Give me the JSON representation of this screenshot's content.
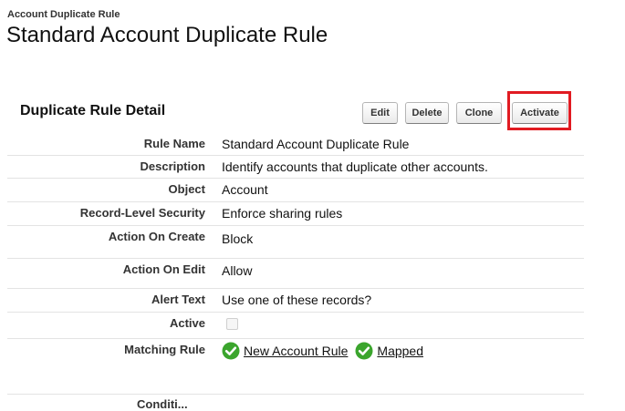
{
  "header": {
    "breadcrumb": "Account Duplicate Rule",
    "title": "Standard Account Duplicate Rule"
  },
  "section": {
    "title": "Duplicate Rule Detail",
    "buttons": {
      "edit": "Edit",
      "delete": "Delete",
      "clone": "Clone",
      "activate": "Activate"
    },
    "highlight_color": "#e11b22"
  },
  "fields": {
    "rule_name": {
      "label": "Rule Name",
      "value": "Standard Account Duplicate Rule"
    },
    "description": {
      "label": "Description",
      "value": "Identify accounts that duplicate other accounts."
    },
    "object": {
      "label": "Object",
      "value": "Account"
    },
    "record_level_security": {
      "label": "Record-Level Security",
      "value": "Enforce sharing rules"
    },
    "action_on_create": {
      "label": "Action On Create",
      "value": "Block"
    },
    "action_on_edit": {
      "label": "Action On Edit",
      "value": "Allow"
    },
    "alert_text": {
      "label": "Alert Text",
      "value": "Use one of these records?"
    },
    "active": {
      "label": "Active",
      "checked": false
    },
    "matching_rule": {
      "label": "Matching Rule",
      "rule_link": "New Account Rule",
      "mapped_link": "Mapped",
      "icon": "green-check-icon",
      "icon_color": "#3ba52d"
    },
    "conditions": {
      "label": "Conditi..."
    }
  }
}
